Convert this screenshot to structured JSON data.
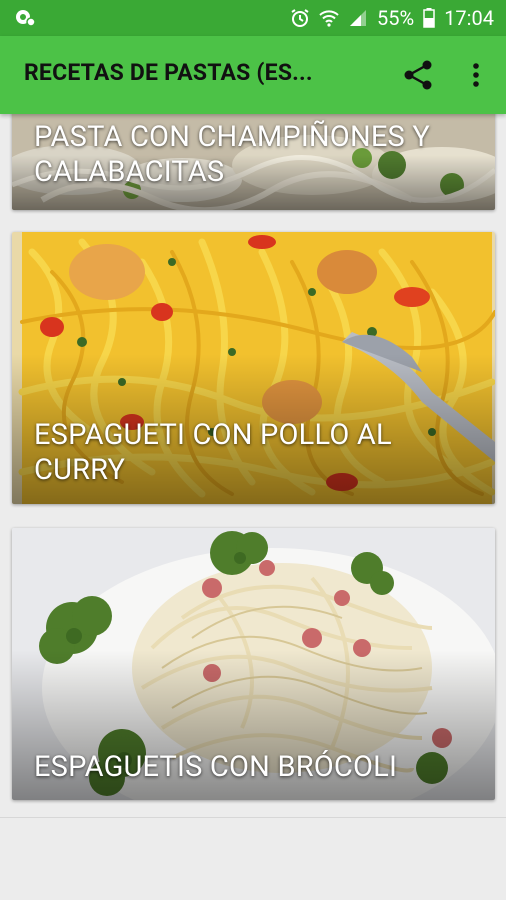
{
  "status_bar": {
    "battery": "55%",
    "time": "17:04"
  },
  "toolbar": {
    "title": "RECETAS DE PASTAS (ES..."
  },
  "recipes": [
    {
      "title": "PASTA CON CHAMPIÑONES Y CALABACITAS"
    },
    {
      "title": "ESPAGUETI CON POLLO AL CURRY"
    },
    {
      "title": "ESPAGUETIS CON BRÓCOLI"
    }
  ],
  "colors": {
    "status_bar": "#3aa935",
    "toolbar": "#4cc247",
    "background": "#ececec"
  }
}
